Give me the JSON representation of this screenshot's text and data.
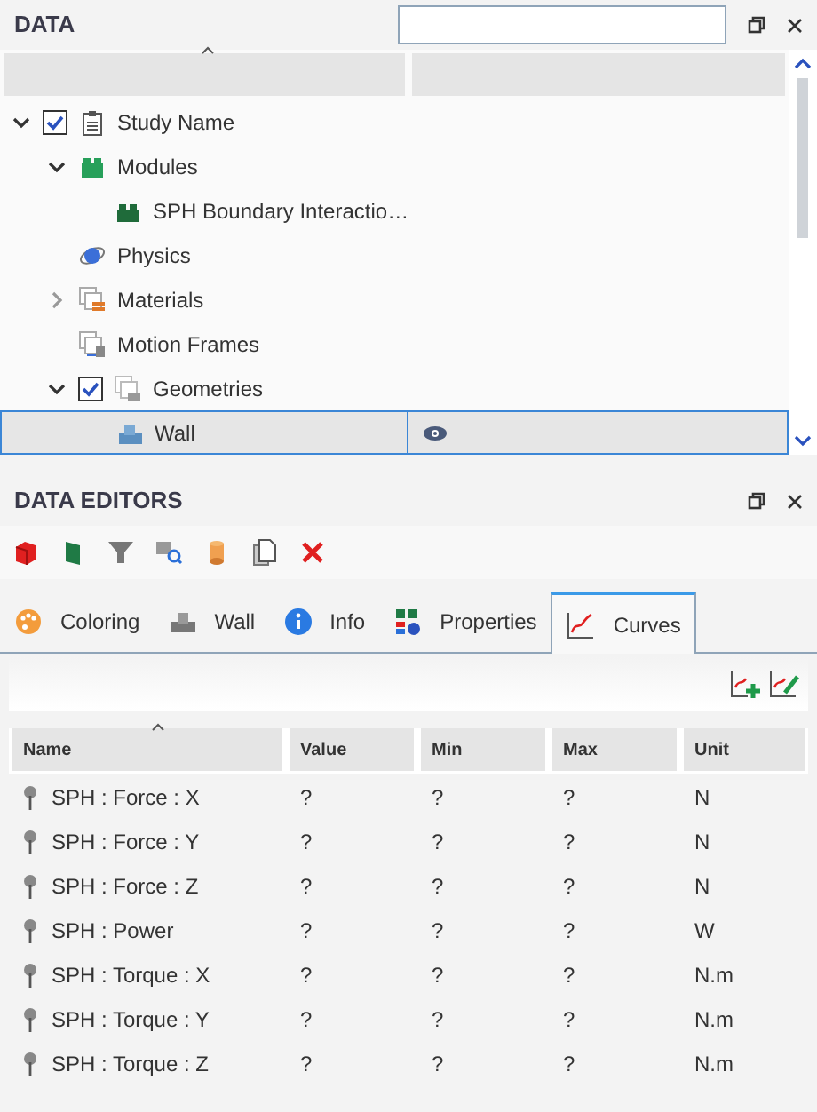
{
  "data_panel": {
    "title": "DATA",
    "tree": [
      {
        "label": "Study Name",
        "kind": "study",
        "expanded": true,
        "checked": true,
        "selected": false,
        "children": [
          {
            "label": "Modules",
            "kind": "modules",
            "expanded": true,
            "selected": false,
            "children": [
              {
                "label": "SPH Boundary Interactio…",
                "kind": "module",
                "selected": false
              }
            ]
          },
          {
            "label": "Physics",
            "kind": "physics",
            "selected": false
          },
          {
            "label": "Materials",
            "kind": "materials",
            "expanded": false,
            "selected": false
          },
          {
            "label": "Motion Frames",
            "kind": "frames",
            "selected": false
          },
          {
            "label": "Geometries",
            "kind": "geometries",
            "expanded": true,
            "checked": true,
            "selected": false,
            "children": [
              {
                "label": "Wall",
                "kind": "wall",
                "selected": true,
                "visible": true
              }
            ]
          }
        ]
      }
    ]
  },
  "editors_panel": {
    "title": "DATA EDITORS",
    "toolbar": [
      {
        "kind": "cube"
      },
      {
        "kind": "panel"
      },
      {
        "kind": "filter"
      },
      {
        "kind": "inspect"
      },
      {
        "kind": "cylinder"
      },
      {
        "kind": "copy"
      },
      {
        "kind": "delete"
      }
    ],
    "tabs": [
      {
        "label": "Coloring",
        "kind": "palette",
        "selected": false
      },
      {
        "label": "Wall",
        "kind": "wall",
        "selected": false
      },
      {
        "label": "Info",
        "kind": "info",
        "selected": false
      },
      {
        "label": "Properties",
        "kind": "properties",
        "selected": false
      },
      {
        "label": "Curves",
        "kind": "curves",
        "selected": true
      }
    ],
    "table": {
      "columns": [
        "Name",
        "Value",
        "Min",
        "Max",
        "Unit"
      ],
      "rows": [
        [
          "SPH : Force : X",
          "?",
          "?",
          "?",
          "N"
        ],
        [
          "SPH : Force : Y",
          "?",
          "?",
          "?",
          "N"
        ],
        [
          "SPH : Force : Z",
          "?",
          "?",
          "?",
          "N"
        ],
        [
          "SPH : Power",
          "?",
          "?",
          "?",
          "W"
        ],
        [
          "SPH : Torque : X",
          "?",
          "?",
          "?",
          "N.m"
        ],
        [
          "SPH : Torque : Y",
          "?",
          "?",
          "?",
          "N.m"
        ],
        [
          "SPH : Torque : Z",
          "?",
          "?",
          "?",
          "N.m"
        ]
      ]
    }
  }
}
